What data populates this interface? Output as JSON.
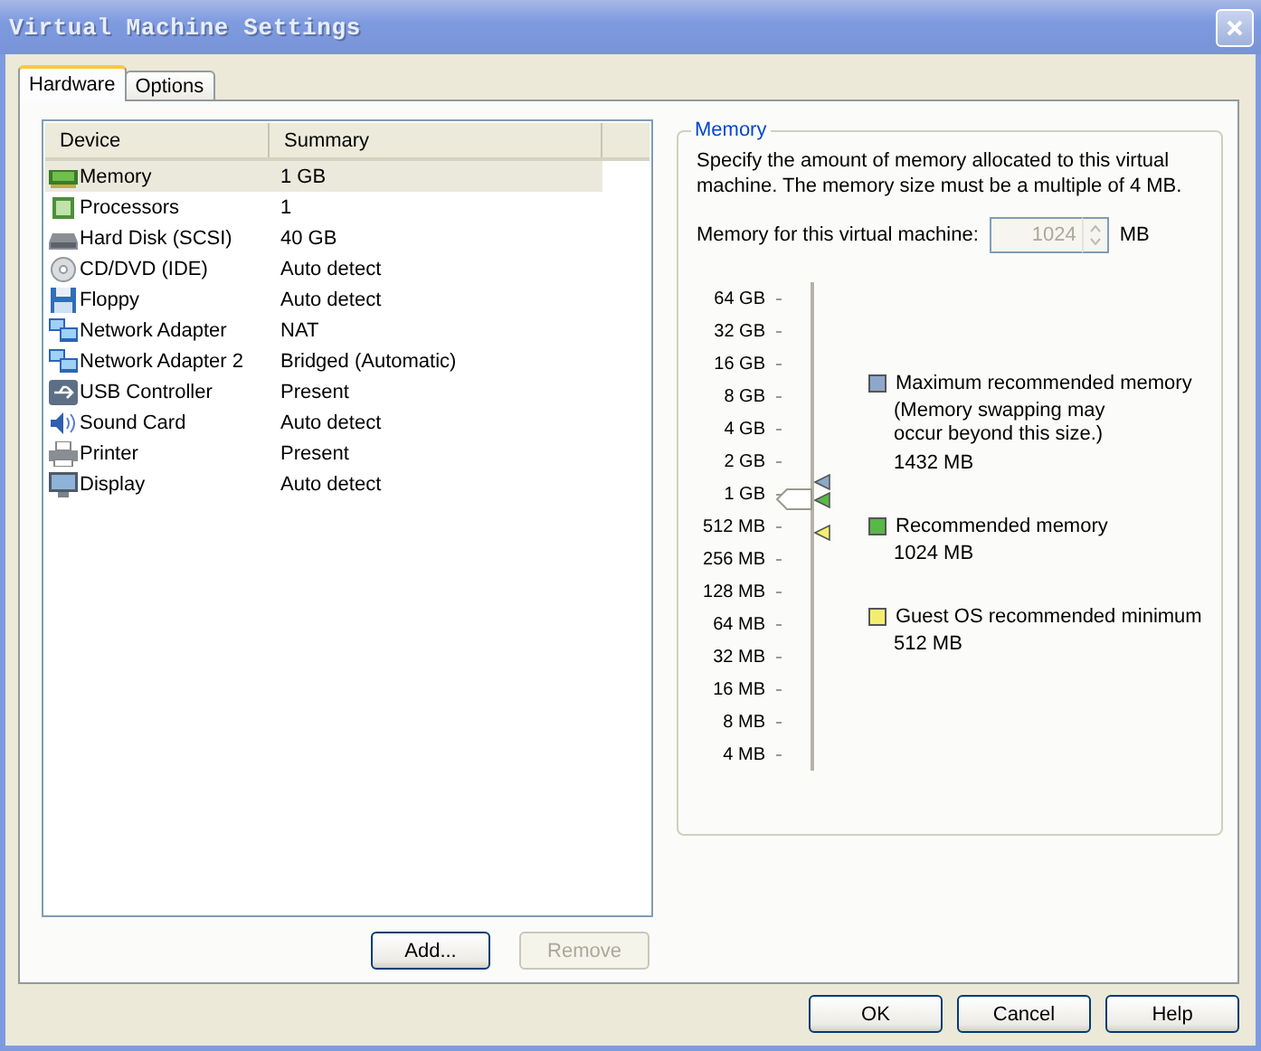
{
  "window": {
    "title": "Virtual Machine Settings"
  },
  "tabs": [
    {
      "label": "Hardware",
      "selected": true
    },
    {
      "label": "Options",
      "selected": false
    }
  ],
  "devices": {
    "columns": [
      "Device",
      "Summary"
    ],
    "rows": [
      {
        "kind": "memory",
        "device": "Memory",
        "summary": "1 GB",
        "selected": true
      },
      {
        "kind": "processor",
        "device": "Processors",
        "summary": "1",
        "selected": false
      },
      {
        "kind": "disk",
        "device": "Hard Disk (SCSI)",
        "summary": "40 GB",
        "selected": false
      },
      {
        "kind": "cd",
        "device": "CD/DVD (IDE)",
        "summary": "Auto detect",
        "selected": false
      },
      {
        "kind": "floppy",
        "device": "Floppy",
        "summary": "Auto detect",
        "selected": false
      },
      {
        "kind": "network",
        "device": "Network Adapter",
        "summary": "NAT",
        "selected": false
      },
      {
        "kind": "network",
        "device": "Network Adapter 2",
        "summary": "Bridged (Automatic)",
        "selected": false
      },
      {
        "kind": "usb",
        "device": "USB Controller",
        "summary": "Present",
        "selected": false
      },
      {
        "kind": "sound",
        "device": "Sound Card",
        "summary": "Auto detect",
        "selected": false
      },
      {
        "kind": "printer",
        "device": "Printer",
        "summary": "Present",
        "selected": false
      },
      {
        "kind": "display",
        "device": "Display",
        "summary": "Auto detect",
        "selected": false
      }
    ]
  },
  "list_buttons": [
    {
      "label": "Add...",
      "disabled": false
    },
    {
      "label": "Remove",
      "disabled": true
    }
  ],
  "memory": {
    "group_title": "Memory",
    "description": "Specify the amount of memory allocated to this virtual machine. The memory size must be a multiple of 4 MB.",
    "field_label": "Memory for this virtual machine:",
    "value": "1024",
    "disabled": true,
    "unit": "MB",
    "slider": {
      "level": 0.571,
      "markers": [
        {
          "level": 0.606
        },
        {
          "level": 0.571
        },
        {
          "level": 0.5
        }
      ],
      "ticks": [
        "64 GB",
        "32 GB",
        "16 GB",
        "8 GB",
        "4 GB",
        "2 GB",
        "1 GB",
        "512 MB",
        "256 MB",
        "128 MB",
        "64 MB",
        "32 MB",
        "16 MB",
        "8 MB",
        "4 MB"
      ]
    },
    "legend": [
      {
        "label": "Maximum recommended memory",
        "note": "(Memory swapping may occur beyond this size.)",
        "value": "1432 MB",
        "color": "#8ea8cc"
      },
      {
        "label": "Recommended memory",
        "value": "1024 MB",
        "color": "#58b848"
      },
      {
        "label": "Guest OS recommended minimum",
        "value": "512 MB",
        "color": "#f4ee70"
      }
    ]
  },
  "buttons": [
    {
      "label": "OK"
    },
    {
      "label": "Cancel"
    },
    {
      "label": "Help"
    }
  ]
}
